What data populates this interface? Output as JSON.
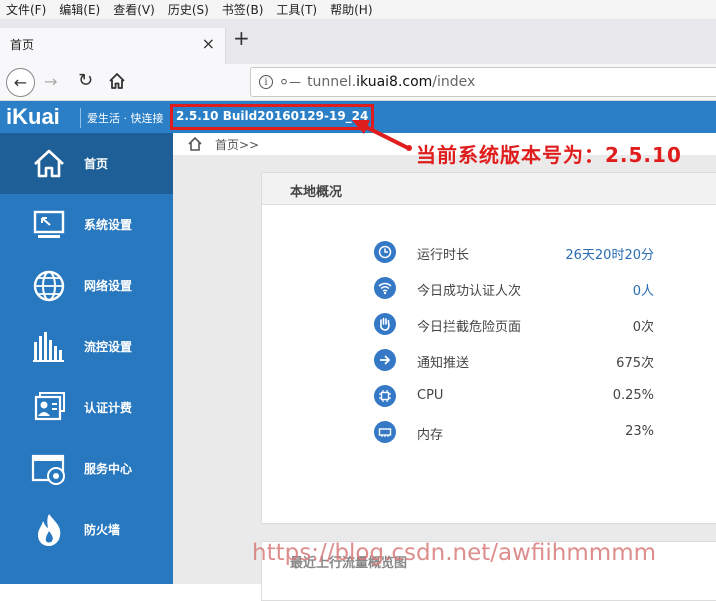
{
  "browser": {
    "menu": [
      "文件(F)",
      "编辑(E)",
      "查看(V)",
      "历史(S)",
      "书签(B)",
      "工具(T)",
      "帮助(H)"
    ],
    "tab_title": "首页",
    "tab_close": "×",
    "new_tab": "+",
    "url_prefix": "tunnel.",
    "url_domain": "ikuai8.com",
    "url_path": "/index"
  },
  "header": {
    "logo": "iKuai",
    "slogan": "爱生活 · 快连接",
    "version": "2.5.10 Build20160129-19_24"
  },
  "sidebar": {
    "items": [
      {
        "label": "首页",
        "icon": "home-icon"
      },
      {
        "label": "系统设置",
        "icon": "monitor-icon"
      },
      {
        "label": "网络设置",
        "icon": "globe-icon"
      },
      {
        "label": "流控设置",
        "icon": "bars-icon"
      },
      {
        "label": "认证计费",
        "icon": "user-card-icon"
      },
      {
        "label": "服务中心",
        "icon": "service-icon"
      },
      {
        "label": "防火墙",
        "icon": "flame-icon"
      }
    ]
  },
  "breadcrumb": "首页>>",
  "overview": {
    "title": "本地概况",
    "rows": [
      {
        "label": "运行时长",
        "value": "26天20时20分",
        "icon": "clock-icon",
        "highlight": true
      },
      {
        "label": "今日成功认证人次",
        "value": "0人",
        "icon": "wifi-icon",
        "highlight": true
      },
      {
        "label": "今日拦截危险页面",
        "value": "0次",
        "icon": "hand-icon",
        "highlight": false
      },
      {
        "label": "通知推送",
        "value": "675次",
        "icon": "arrow-right-icon",
        "highlight": false
      },
      {
        "label": "CPU",
        "value": "0.25%",
        "icon": "cpu-icon",
        "highlight": false
      },
      {
        "label": "内存",
        "value": "23%",
        "icon": "memory-icon",
        "highlight": false
      }
    ]
  },
  "traffic_panel": {
    "title": "最近上行流量概览图"
  },
  "annotation": {
    "text": "当前系统版本号为：2.5.10",
    "color": "#e01d1d"
  },
  "watermark": "https://blog.csdn.net/awfiihmmmm",
  "colors": {
    "accent": "#2a7fc7",
    "sidebar": "#2878bf",
    "sidebar_active": "#1e5f97",
    "icon_blue": "#3478c6"
  }
}
